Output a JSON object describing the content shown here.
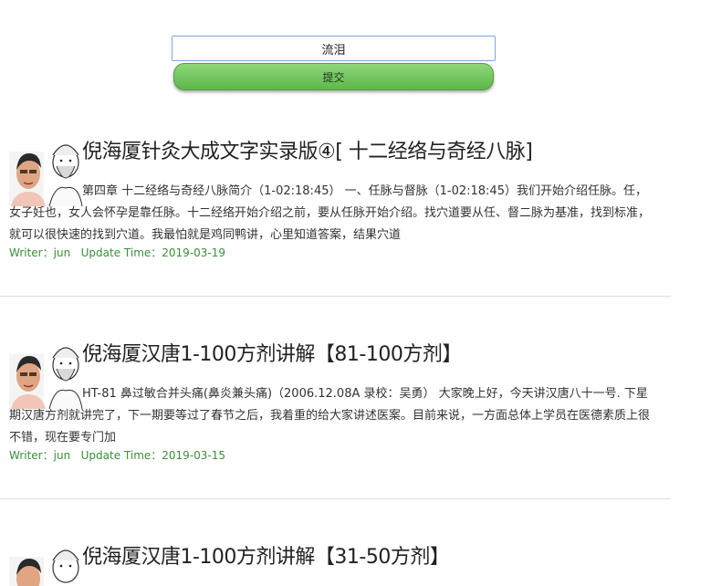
{
  "search": {
    "value": "流泪",
    "submit_label": "提交"
  },
  "articles": [
    {
      "title": "倪海厦针灸大成文字实录版④[ 十二经络与奇经八脉]",
      "excerpt": "第四章 十二经络与奇经八脉简介（1-02:18:45） 一、任脉与督脉（1-02:18:45）我们开始介绍任脉。任，女子妊也，女人会怀孕是靠任脉。十二经络开始介绍之前，要从任脉开始介绍。找穴道要从任、督二脉为基准，找到标准，就可以很快速的找到穴道。我最怕就是鸡同鸭讲，心里知道答案，结果穴道",
      "writer_label": "Writer：",
      "writer": "jun",
      "update_label": "Update Time：",
      "update_time": "2019-03-19"
    },
    {
      "title": "倪海厦汉唐1-100方剂讲解【81-100方剂】",
      "excerpt": "HT-81 鼻过敏合并头痛(鼻炎兼头痛)（2006.12.08A 录校：吴勇） 大家晚上好，今天讲汉唐八十一号. 下星期汉唐方剂就讲完了，下一期要等过了春节之后，我着重的给大家讲述医案。目前来说，一方面总体上学员在医德素质上很不错，现在要专门加",
      "writer_label": "Writer：",
      "writer": "jun",
      "update_label": "Update Time：",
      "update_time": "2019-03-15"
    },
    {
      "title": "倪海厦汉唐1-100方剂讲解【31-50方剂】"
    }
  ]
}
